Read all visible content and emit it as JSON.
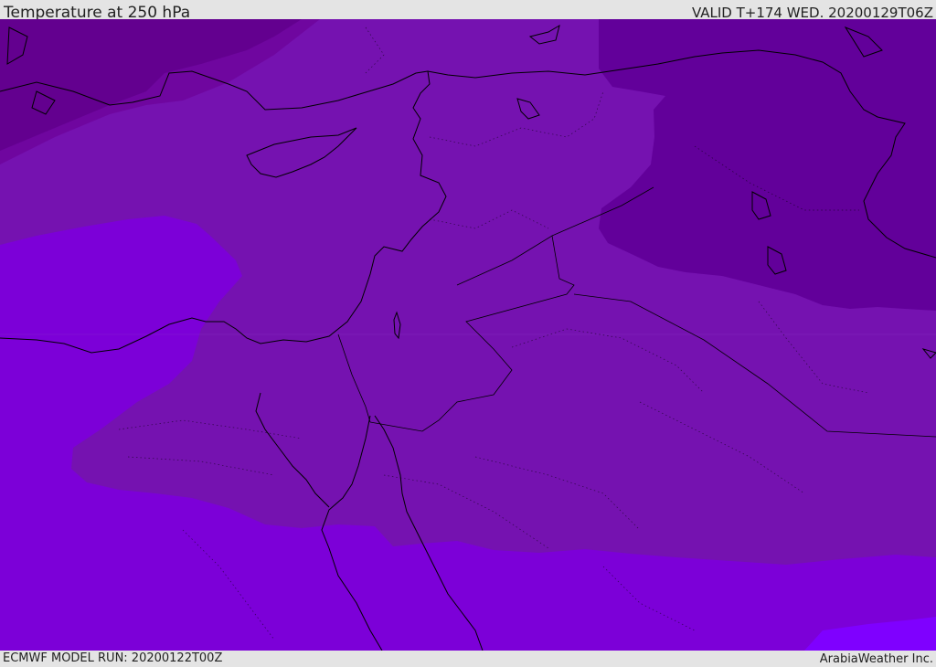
{
  "header": {
    "title": "Temperature at 250 hPa",
    "valid": "VALID T+174 WED. 20200129T06Z"
  },
  "footer": {
    "model_run": "ECMWF MODEL RUN: 20200122T00Z",
    "credit": "ArabiaWeather Inc."
  },
  "colors": {
    "band_coldest": "#5f0090",
    "band_cold": "#6f069f",
    "band_mid": "#7512b0",
    "band_warm": "#7c00d8",
    "band_warmest": "#7f00ff",
    "coastline": "#000000"
  }
}
